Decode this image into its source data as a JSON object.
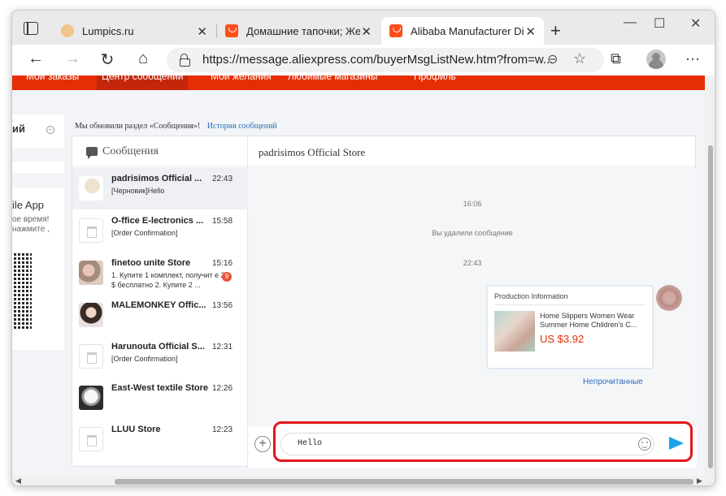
{
  "browser": {
    "tabs": [
      {
        "title": "Lumpics.ru",
        "close": "✕"
      },
      {
        "title": "Домашние тапочки; Жен",
        "close": "✕"
      },
      {
        "title": "Alibaba Manufacturer Dir",
        "close": "✕"
      }
    ],
    "new_tab": "+",
    "window_controls": {
      "minimize": "—",
      "maximize": "☐",
      "close": "✕"
    },
    "nav": {
      "back": "←",
      "forward": "→",
      "reload": "↻",
      "home": "⌂"
    },
    "url": "https://message.aliexpress.com/buyerMsgListNew.htm?from=w...",
    "tool_icons": {
      "zoom": "⊖",
      "favorite": "☆",
      "collections": "⧉",
      "menu": "···"
    }
  },
  "site": {
    "topnav": [
      "Мои заказы",
      "Центр сообщений",
      "Мои желания",
      "Любимые магазины",
      "Профиль"
    ],
    "left": {
      "section_title": "ий",
      "collapse": "−",
      "app_title": "ile App",
      "app_line1": "ое время!",
      "app_line2": "нажмите ,"
    },
    "notice": "Мы обновили раздел «Сообщения»!",
    "history_link": "История сообщений"
  },
  "messages": {
    "header": "Сообщения",
    "conversations": [
      {
        "name": "padrisimos Official ...",
        "time": "22:43",
        "preview": "[Черновик]Hello",
        "avatar": "slipper"
      },
      {
        "name": "O-ffice E-lectronics ...",
        "time": "15:58",
        "preview": "[Order Confirmation]",
        "avatar": "store"
      },
      {
        "name": "finetoo unite Store",
        "time": "15:16",
        "preview": "1. Купите 1 комплект, получит е 2 $ бесплатно 2. Купите 2 ...",
        "badge": "9",
        "avatar": "pink"
      },
      {
        "name": "MALEMONKEY Offic...",
        "time": "13:56",
        "preview": "",
        "avatar": "girl"
      },
      {
        "name": "Harunouta Official S...",
        "time": "12:31",
        "preview": "[Order Confirmation]",
        "avatar": "store"
      },
      {
        "name": "East-West textile Store",
        "time": "12:26",
        "preview": "",
        "avatar": "flower"
      },
      {
        "name": "LLUU Store",
        "time": "12:23",
        "preview": "",
        "avatar": "store"
      }
    ]
  },
  "chat": {
    "store_name": "padrisimos Official Store",
    "system": [
      "16:06",
      "Вы удалили сообщение",
      "22:43"
    ],
    "card": {
      "title": "Production Information",
      "product": "Home Slippers Women Wear Summer Home Children's C...",
      "price": "US $3.92"
    },
    "unread": "Непрочитанные",
    "input_value": "Hello",
    "plus": "+"
  },
  "colors": {
    "brand": "#e62e04",
    "highlight": "#e3161b",
    "send": "#1aa3e8",
    "link": "#2a6ebb"
  }
}
